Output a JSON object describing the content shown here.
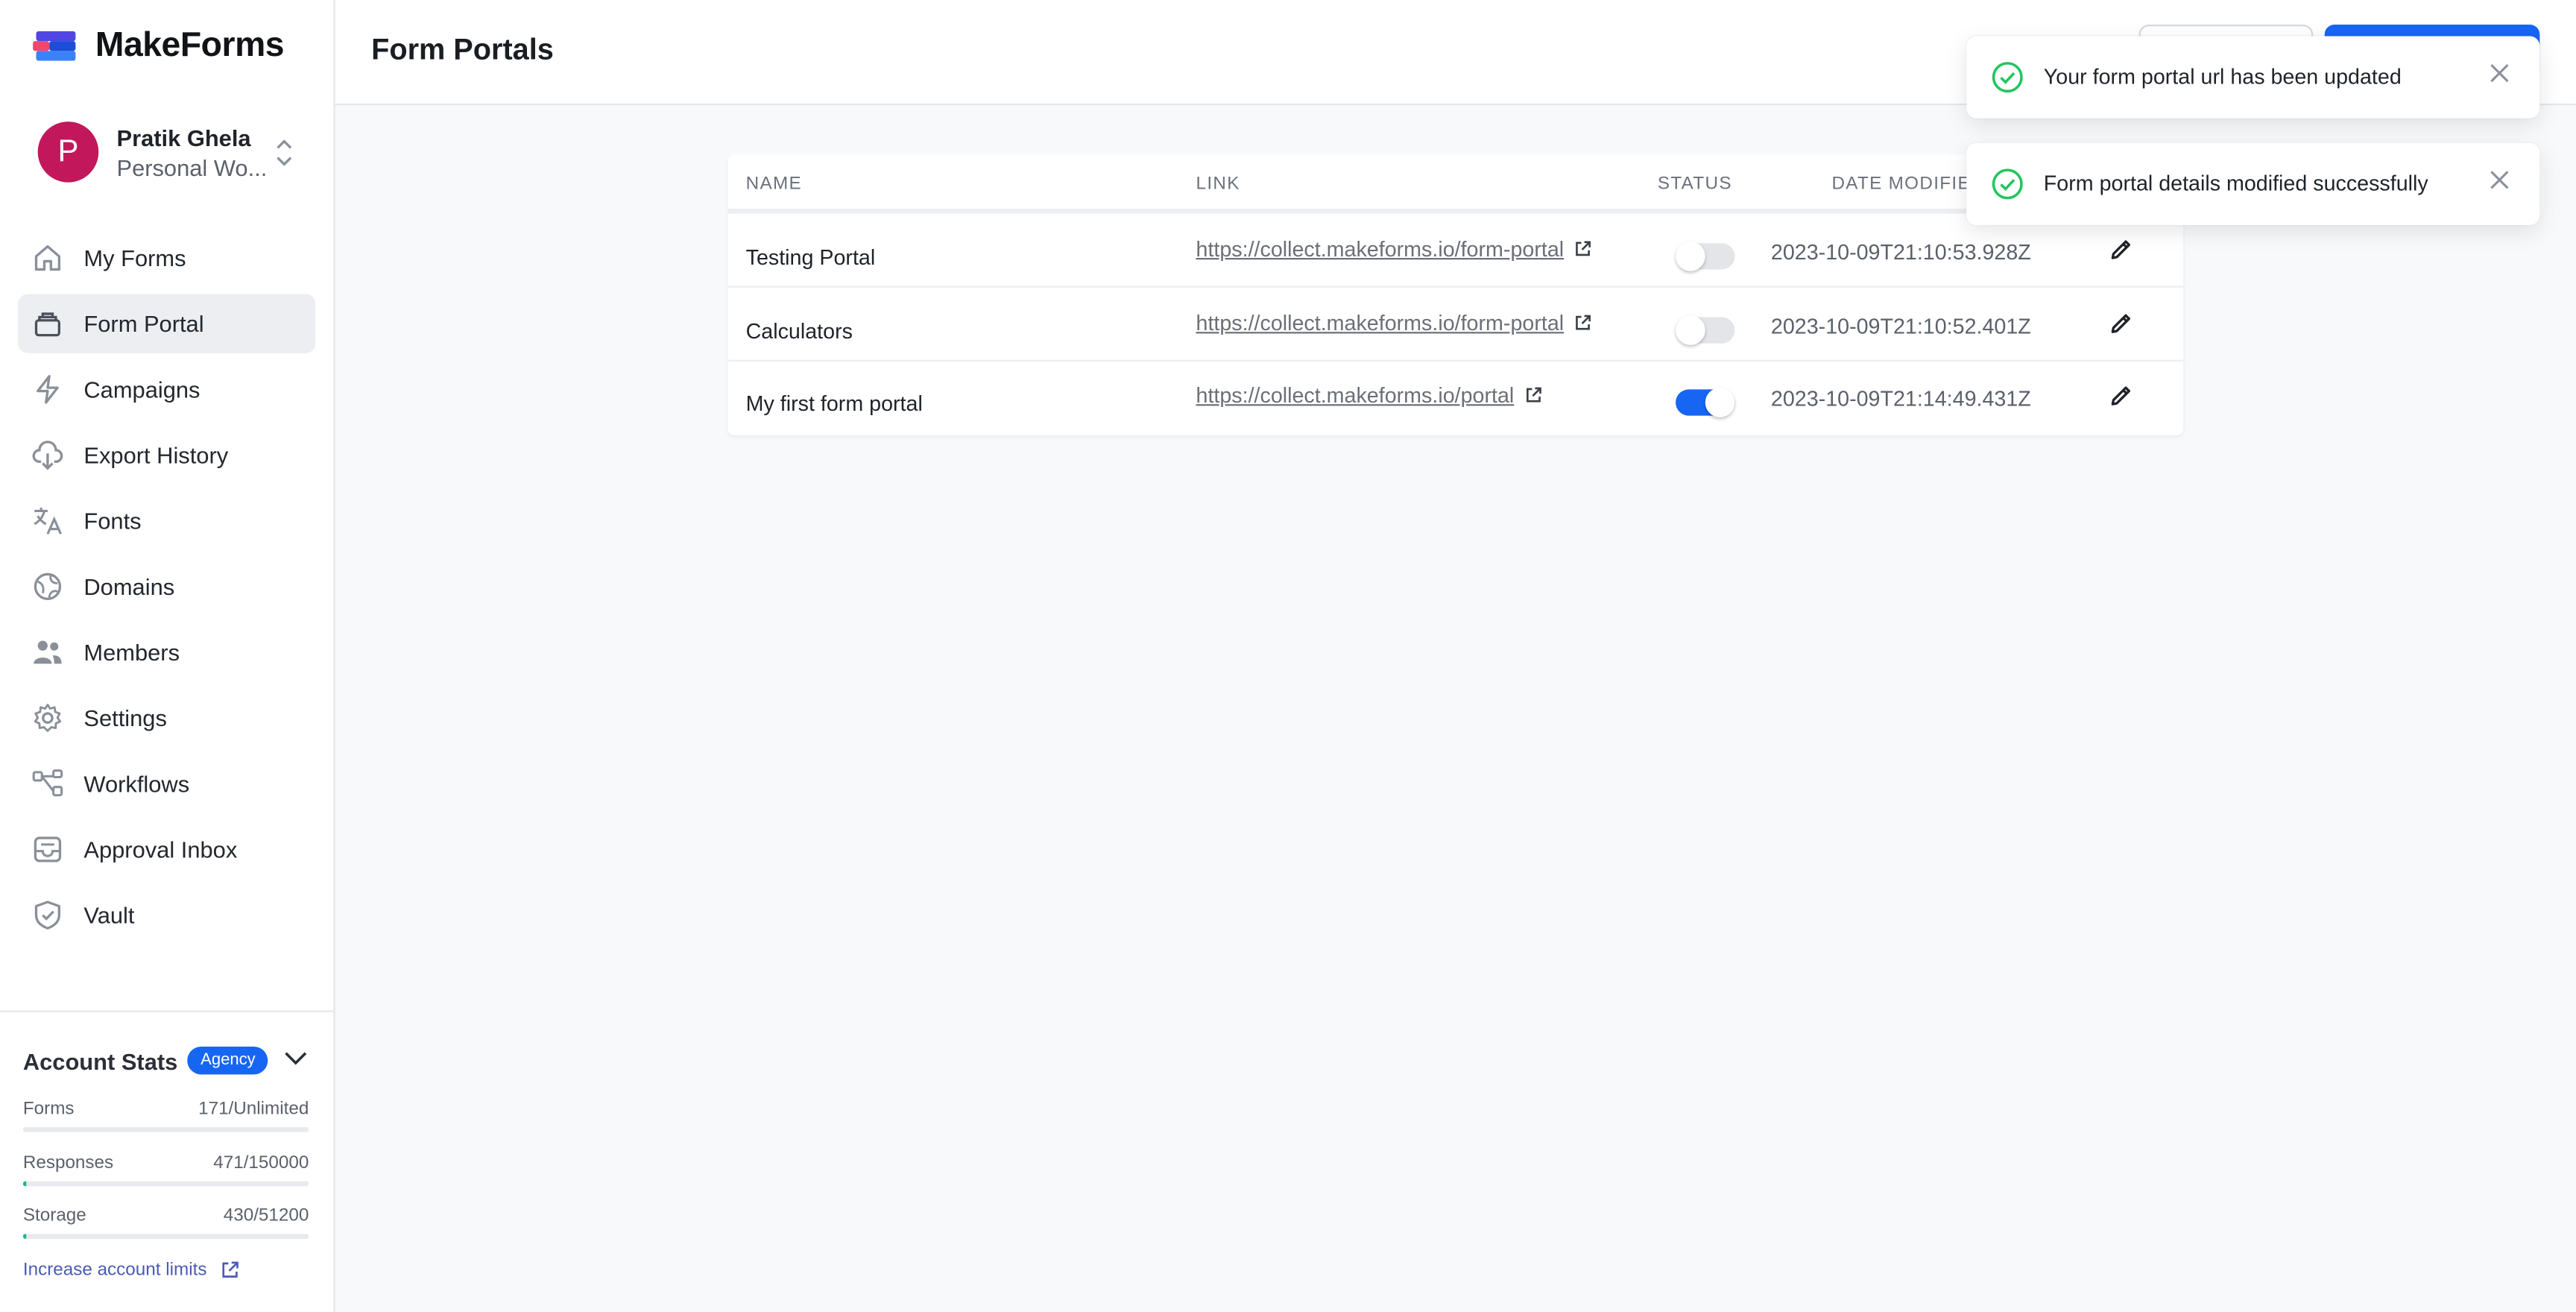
{
  "app": {
    "name": "MakeForms"
  },
  "user": {
    "initial": "P",
    "name": "Pratik Ghela",
    "workspace": "Personal Wo..."
  },
  "nav": {
    "items": [
      {
        "label": "My Forms",
        "icon": "home-icon"
      },
      {
        "label": "Form Portal",
        "icon": "portal-icon",
        "active": true
      },
      {
        "label": "Campaigns",
        "icon": "bolt-icon"
      },
      {
        "label": "Export History",
        "icon": "cloud-download-icon"
      },
      {
        "label": "Fonts",
        "icon": "translate-icon"
      },
      {
        "label": "Domains",
        "icon": "globe-icon"
      },
      {
        "label": "Members",
        "icon": "users-icon"
      },
      {
        "label": "Settings",
        "icon": "gear-icon"
      },
      {
        "label": "Workflows",
        "icon": "workflow-icon"
      },
      {
        "label": "Approval Inbox",
        "icon": "inbox-icon"
      },
      {
        "label": "Vault",
        "icon": "shield-icon"
      }
    ]
  },
  "stats": {
    "title": "Account Stats",
    "badge": "Agency",
    "items": [
      {
        "label": "Forms",
        "value": "171/Unlimited",
        "fill_fraction": 0.0
      },
      {
        "label": "Responses",
        "value": "471/150000",
        "fill_fraction": 0.003
      },
      {
        "label": "Storage",
        "value": "430/51200",
        "fill_fraction": 0.008
      }
    ],
    "limits_link": "Increase account limits",
    "accent": "#20b486"
  },
  "header": {
    "title": "Form Portals"
  },
  "table": {
    "columns": {
      "name": "NAME",
      "link": "LINK",
      "status": "STATUS",
      "date": "DATE MODIFIE"
    },
    "rows": [
      {
        "name": "Testing Portal",
        "link": "https://collect.makeforms.io/form-portal",
        "status": false,
        "date": "2023-10-09T21:10:53.928Z"
      },
      {
        "name": "Calculators",
        "link": "https://collect.makeforms.io/form-portal",
        "status": false,
        "date": "2023-10-09T21:10:52.401Z"
      },
      {
        "name": "My first form portal",
        "link": "https://collect.makeforms.io/portal",
        "status": true,
        "date": "2023-10-09T21:14:49.431Z"
      }
    ]
  },
  "toasts": [
    {
      "message": "Your form portal url has been updated"
    },
    {
      "message": "Form portal details modified successfully"
    }
  ],
  "colors": {
    "primary": "#1766f3",
    "success": "#22c55e",
    "avatar": "#c2185b"
  }
}
